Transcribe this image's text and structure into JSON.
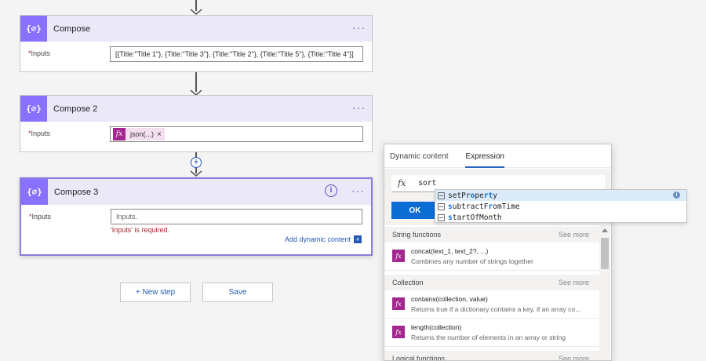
{
  "flow": {
    "steps": [
      {
        "title": "Compose",
        "input_label": "Inputs",
        "required_mark": "*",
        "input_value": "[{Title:\"Title 1\"}, {Title:\"Title 3\"}, {Title:\"Title 2\"}, {Title:\"Title 5\"}, {Title:\"Title 4\"}]"
      },
      {
        "title": "Compose 2",
        "input_label": "Inputs",
        "required_mark": "*",
        "token_label": "json(...)",
        "token_remove": "×",
        "token_icon": "fx-icon"
      },
      {
        "title": "Compose 3",
        "input_label": "Inputs",
        "required_mark": "*",
        "input_placeholder": "Inputs.",
        "error": "'Inputs' is required.",
        "add_dynamic": "Add dynamic content",
        "add_dynamic_icon": "+"
      }
    ],
    "more_icon": "···",
    "info_icon": "i",
    "insert_icon": "+",
    "new_step": "+ New step",
    "save": "Save"
  },
  "panel": {
    "tabs": [
      {
        "label": "Dynamic content",
        "active": false
      },
      {
        "label": "Expression",
        "active": true
      }
    ],
    "expression_text": "sort",
    "fx_glyph": "fx",
    "ok": "OK",
    "sections": [
      {
        "name": "String functions",
        "more": "See more",
        "items": [
          {
            "name": "concat(text_1, text_2?, ...)",
            "desc": "Combines any number of strings together"
          }
        ]
      },
      {
        "name": "Collection",
        "more": "See more",
        "items": [
          {
            "name": "contains(collection, value)",
            "desc": "Returns true if a dictionary contains a key, if an array co..."
          },
          {
            "name": "length(collection)",
            "desc": "Returns the number of elements in an array or string"
          }
        ]
      },
      {
        "name": "Logical functions",
        "more": "See more",
        "items": []
      }
    ]
  },
  "suggestions": {
    "items": [
      {
        "pre": "setPr",
        "hl": "o",
        "mid": "pe",
        "hl2": "rt",
        "post": "y",
        "selected": true
      },
      {
        "pre": "",
        "hl": "s",
        "mid": "ubtractF",
        "hl2": "r",
        "post": "omTime",
        "selected": false
      },
      {
        "pre": "",
        "hl": "s",
        "mid": "tartOfMonth",
        "hl2": "",
        "post": "",
        "selected": false
      }
    ],
    "info_icon": "i",
    "accent": "#0b6cd4"
  },
  "colors": {
    "compose_icon_bg": "#8a70ff",
    "card_header_bg": "#ebe8f7",
    "fx_token_bg": "#a3278f",
    "link_blue": "#2359b5",
    "error_red": "#a4262c"
  }
}
